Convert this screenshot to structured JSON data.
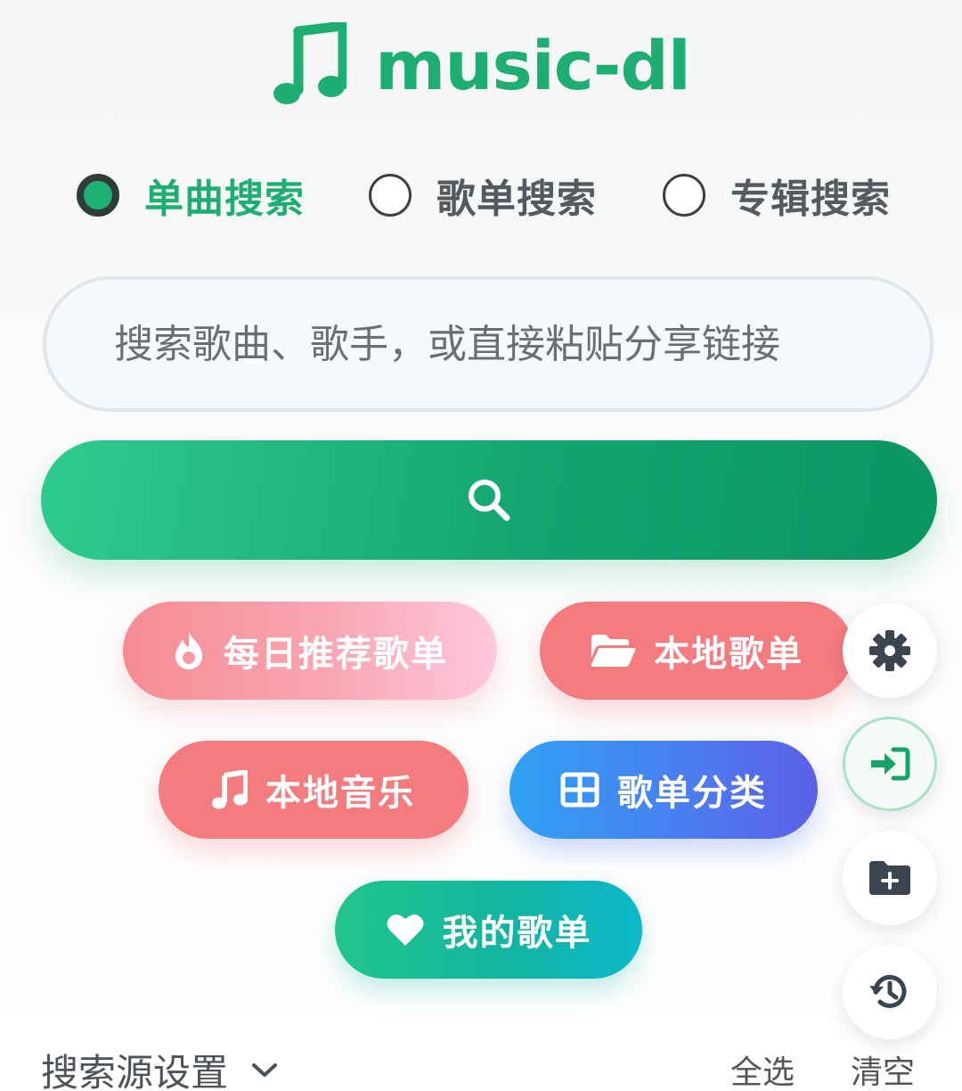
{
  "header": {
    "title": "music-dl",
    "logo_icon": "music-note-icon",
    "brand_color": "#1fae72"
  },
  "modes": [
    {
      "label": "单曲搜索",
      "selected": true
    },
    {
      "label": "歌单搜索",
      "selected": false
    },
    {
      "label": "专辑搜索",
      "selected": false
    }
  ],
  "search": {
    "placeholder": "搜索歌曲、歌手，或直接粘贴分享链接",
    "value": "",
    "button_icon": "search-icon"
  },
  "quick_actions": {
    "daily": {
      "label": "每日推荐歌单",
      "icon": "fire-icon"
    },
    "local_playlists": {
      "label": "本地歌单",
      "icon": "folder-open-icon"
    },
    "local_music": {
      "label": "本地音乐",
      "icon": "music-note-icon"
    },
    "categories": {
      "label": "歌单分类",
      "icon": "grid-icon"
    },
    "my_playlists": {
      "label": "我的歌单",
      "icon": "heart-icon"
    }
  },
  "side_buttons": [
    "gear-icon",
    "login-icon",
    "folder-plus-icon",
    "history-icon"
  ],
  "source_settings": {
    "title": "搜索源设置",
    "select_all": "全选",
    "clear": "清空"
  }
}
